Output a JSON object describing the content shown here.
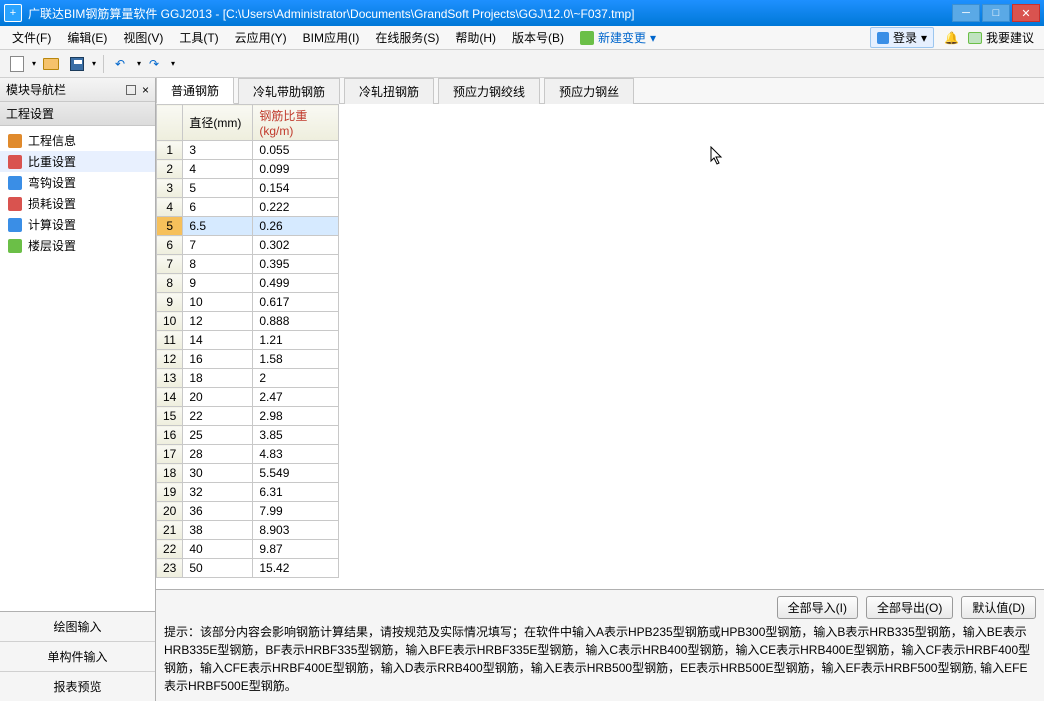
{
  "title": "广联达BIM钢筋算量软件 GGJ2013 - [C:\\Users\\Administrator\\Documents\\GrandSoft Projects\\GGJ\\12.0\\~F037.tmp]",
  "menu": {
    "items": [
      "文件(F)",
      "编辑(E)",
      "视图(V)",
      "工具(T)",
      "云应用(Y)",
      "BIM应用(I)",
      "在线服务(S)",
      "帮助(H)",
      "版本号(B)"
    ],
    "new_change": "新建变更",
    "login": "登录",
    "suggest": "我要建议"
  },
  "left": {
    "nav_title": "模块导航栏",
    "section": "工程设置",
    "tree": [
      {
        "label": "工程信息",
        "color": "#e08a2c"
      },
      {
        "label": "比重设置",
        "color": "#d9534f"
      },
      {
        "label": "弯钩设置",
        "color": "#3a8ee6"
      },
      {
        "label": "损耗设置",
        "color": "#d9534f"
      },
      {
        "label": "计算设置",
        "color": "#3a8ee6"
      },
      {
        "label": "楼层设置",
        "color": "#6bbf47"
      }
    ],
    "bottom_tabs": [
      "绘图输入",
      "单构件输入",
      "报表预览"
    ]
  },
  "tabs": [
    "普通钢筋",
    "冷轧带肋钢筋",
    "冷轧扭钢筋",
    "预应力钢绞线",
    "预应力钢丝"
  ],
  "active_tab": 0,
  "grid": {
    "headers": [
      "直径(mm)",
      "钢筋比重(kg/m)"
    ],
    "rows": [
      {
        "n": 1,
        "d": "3",
        "w": "0.055"
      },
      {
        "n": 2,
        "d": "4",
        "w": "0.099"
      },
      {
        "n": 3,
        "d": "5",
        "w": "0.154"
      },
      {
        "n": 4,
        "d": "6",
        "w": "0.222"
      },
      {
        "n": 5,
        "d": "6.5",
        "w": "0.26",
        "selected": true
      },
      {
        "n": 6,
        "d": "7",
        "w": "0.302"
      },
      {
        "n": 7,
        "d": "8",
        "w": "0.395"
      },
      {
        "n": 8,
        "d": "9",
        "w": "0.499"
      },
      {
        "n": 9,
        "d": "10",
        "w": "0.617"
      },
      {
        "n": 10,
        "d": "12",
        "w": "0.888"
      },
      {
        "n": 11,
        "d": "14",
        "w": "1.21"
      },
      {
        "n": 12,
        "d": "16",
        "w": "1.58"
      },
      {
        "n": 13,
        "d": "18",
        "w": "2"
      },
      {
        "n": 14,
        "d": "20",
        "w": "2.47"
      },
      {
        "n": 15,
        "d": "22",
        "w": "2.98"
      },
      {
        "n": 16,
        "d": "25",
        "w": "3.85"
      },
      {
        "n": 17,
        "d": "28",
        "w": "4.83"
      },
      {
        "n": 18,
        "d": "30",
        "w": "5.549"
      },
      {
        "n": 19,
        "d": "32",
        "w": "6.31"
      },
      {
        "n": 20,
        "d": "36",
        "w": "7.99"
      },
      {
        "n": 21,
        "d": "38",
        "w": "8.903"
      },
      {
        "n": 22,
        "d": "40",
        "w": "9.87"
      },
      {
        "n": 23,
        "d": "50",
        "w": "15.42"
      }
    ]
  },
  "footer": {
    "buttons": [
      "全部导入(I)",
      "全部导出(O)",
      "默认值(D)"
    ],
    "hint": "提示：该部分内容会影响钢筋计算结果，请按规范及实际情况填写；在软件中输入A表示HPB235型钢筋或HPB300型钢筋，输入B表示HRB335型钢筋，输入BE表示HRB335E型钢筋，BF表示HRBF335型钢筋，输入BFE表示HRBF335E型钢筋，输入C表示HRB400型钢筋，输入CE表示HRB400E型钢筋，输入CF表示HRBF400型钢筋，输入CFE表示HRBF400E型钢筋，输入D表示RRB400型钢筋，输入E表示HRB500型钢筋，EE表示HRB500E型钢筋，输入EF表示HRBF500型钢筋, 输入EFE表示HRBF500E型钢筋。"
  }
}
